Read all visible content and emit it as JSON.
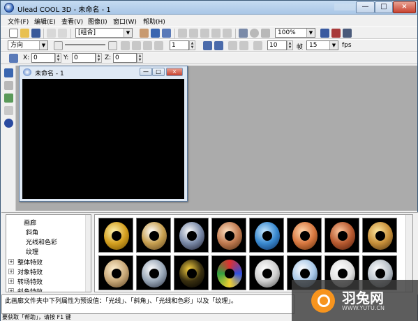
{
  "window": {
    "title": "Ulead COOL 3D - 未命名 - 1",
    "close": "×",
    "max": "□",
    "min": "—"
  },
  "menu": [
    "文件(F)",
    "编辑(E)",
    "查看(V)",
    "图像(I)",
    "窗口(W)",
    "帮助(H)"
  ],
  "toolbar1": {
    "object_select": "[组合]",
    "zoom": "100%"
  },
  "toolbar2": {
    "direction": "方向",
    "frame": "1",
    "fps_frames": "10",
    "zhen": "帧",
    "fps_value": "15",
    "fps_label": "fps"
  },
  "toolbar3": {
    "x_label": "X:",
    "x_value": "0",
    "y_label": "Y:",
    "y_value": "0",
    "z_label": "Z:",
    "z_value": "0"
  },
  "child_window": {
    "title": "未命名 - 1"
  },
  "tree": {
    "items": [
      {
        "label": "画廊",
        "expand": ""
      },
      {
        "label": "斜角",
        "expand": ""
      },
      {
        "label": "光线和色彩",
        "expand": ""
      },
      {
        "label": "纹理",
        "expand": ""
      },
      {
        "label": "整体特效",
        "expand": "+"
      },
      {
        "label": "对象特效",
        "expand": "+"
      },
      {
        "label": "转场特效",
        "expand": "+"
      },
      {
        "label": "斜角特效",
        "expand": "+"
      }
    ]
  },
  "gallery": {
    "thumbnails": [
      {
        "name": "gold"
      },
      {
        "name": "gold-chrome"
      },
      {
        "name": "silver-glow"
      },
      {
        "name": "copper"
      },
      {
        "name": "blue-stone"
      },
      {
        "name": "copper-orange"
      },
      {
        "name": "rust-red"
      },
      {
        "name": "bronze"
      },
      {
        "name": "tan-dots"
      },
      {
        "name": "steel"
      },
      {
        "name": "black-gold"
      },
      {
        "name": "multicolor"
      },
      {
        "name": "white-pattern"
      },
      {
        "name": "ice-blue"
      },
      {
        "name": "white-smooth"
      },
      {
        "name": "silver-dots"
      }
    ]
  },
  "description": "此画廊文件夹中下列属性为预设值：「光线」、「斜角」、「光线和色彩」以及「纹理」。",
  "status": "要获取「帮助」，请按 F1 键",
  "watermark": {
    "brand": "羽兔网",
    "url": "WWW.YUTU.CN"
  }
}
